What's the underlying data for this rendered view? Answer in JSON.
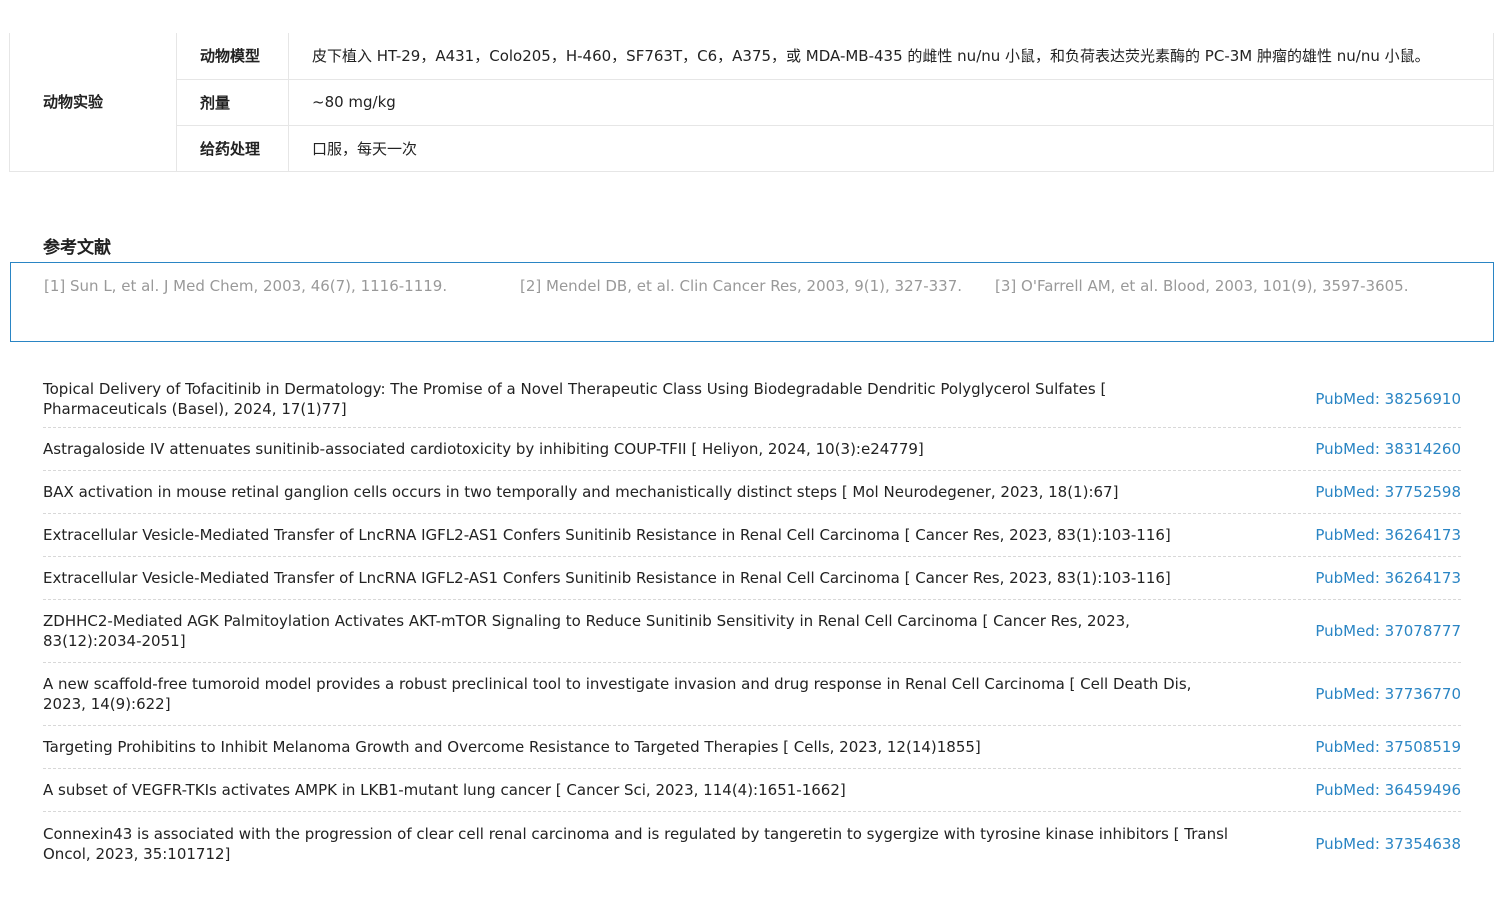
{
  "animal_experiment": {
    "group_label": "动物实验",
    "rows": [
      {
        "key": "动物模型",
        "value": "皮下植入 HT-29，A431，Colo205，H-460，SF763T，C6，A375，或 MDA-MB-435 的雌性 nu/nu 小鼠，和负荷表达荧光素酶的 PC-3M 肿瘤的雄性 nu/nu 小鼠。"
      },
      {
        "key": "剂量",
        "value": "~80 mg/kg"
      },
      {
        "key": "给药处理",
        "value": "口服，每天一次"
      }
    ]
  },
  "references": {
    "title": "参考文献",
    "items": [
      "[1] Sun L, et al. J Med Chem, 2003, 46(7), 1116-1119.",
      "[2] Mendel DB, et al. Clin Cancer Res, 2003, 9(1), 327-337.",
      "[3] O'Farrell AM, et al. Blood, 2003, 101(9), 3597-3605."
    ]
  },
  "citations": [
    {
      "text": "Topical Delivery of Tofacitinib in Dermatology: The Promise of a Novel Therapeutic Class Using Biodegradable Dendritic Polyglycerol Sulfates [ Pharmaceuticals (Basel), 2024, 17(1)77]",
      "pubmed": "PubMed: 38256910"
    },
    {
      "text": "Astragaloside IV attenuates sunitinib-associated cardiotoxicity by inhibiting COUP-TFII [ Heliyon, 2024, 10(3):e24779]",
      "pubmed": "PubMed: 38314260"
    },
    {
      "text": "BAX activation in mouse retinal ganglion cells occurs in two temporally and mechanistically distinct steps [ Mol Neurodegener, 2023, 18(1):67]",
      "pubmed": "PubMed: 37752598"
    },
    {
      "text": "Extracellular Vesicle-Mediated Transfer of LncRNA IGFL2-AS1 Confers Sunitinib Resistance in Renal Cell Carcinoma [ Cancer Res, 2023, 83(1):103-116]",
      "pubmed": "PubMed: 36264173"
    },
    {
      "text": "Extracellular Vesicle-Mediated Transfer of LncRNA IGFL2-AS1 Confers Sunitinib Resistance in Renal Cell Carcinoma [ Cancer Res, 2023, 83(1):103-116]",
      "pubmed": "PubMed: 36264173"
    },
    {
      "text": "ZDHHC2-Mediated AGK Palmitoylation Activates AKT-mTOR Signaling to Reduce Sunitinib Sensitivity in Renal Cell Carcinoma [ Cancer Res, 2023, 83(12):2034-2051]",
      "pubmed": "PubMed: 37078777"
    },
    {
      "text": "A new scaffold-free tumoroid model provides a robust preclinical tool to investigate invasion and drug response in Renal Cell Carcinoma [ Cell Death Dis, 2023, 14(9):622]",
      "pubmed": "PubMed: 37736770"
    },
    {
      "text": "Targeting Prohibitins to Inhibit Melanoma Growth and Overcome Resistance to Targeted Therapies [ Cells, 2023, 12(14)1855]",
      "pubmed": "PubMed: 37508519"
    },
    {
      "text": "A subset of VEGFR-TKIs activates AMPK in LKB1-mutant lung cancer [ Cancer Sci, 2023, 114(4):1651-1662]",
      "pubmed": "PubMed: 36459496"
    },
    {
      "text": "Connexin43 is associated with the progression of clear cell renal carcinoma and is regulated by tangeretin to sygergize with tyrosine kinase inhibitors [ Transl Oncol, 2023, 35:101712]",
      "pubmed": "PubMed: 37354638"
    }
  ]
}
